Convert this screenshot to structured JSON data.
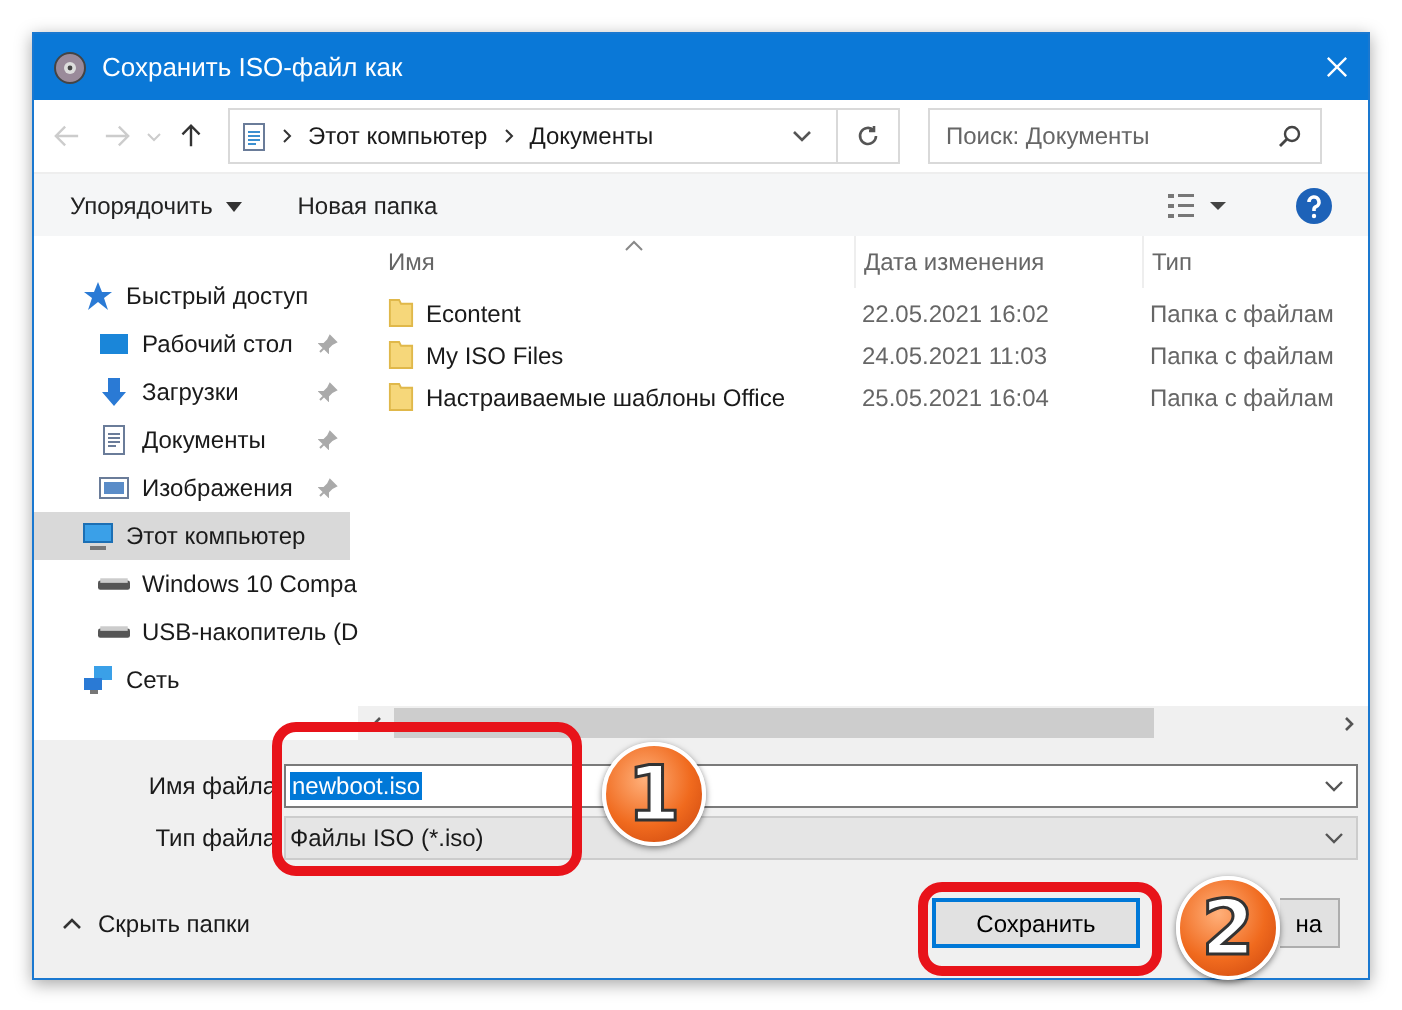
{
  "window": {
    "title": "Сохранить ISO-файл как"
  },
  "address": {
    "path": [
      {
        "label": "Этот компьютер"
      },
      {
        "label": "Документы"
      }
    ]
  },
  "search": {
    "placeholder": "Поиск: Документы"
  },
  "toolbar": {
    "organize": "Упорядочить",
    "new_folder": "Новая папка"
  },
  "sidebar": {
    "items": [
      {
        "label": "Быстрый доступ",
        "kind": "star",
        "selected": false,
        "children": [
          {
            "label": "Рабочий стол",
            "kind": "desktop",
            "selected": false,
            "pinned": true
          },
          {
            "label": "Загрузки",
            "kind": "download",
            "selected": false,
            "pinned": true
          },
          {
            "label": "Документы",
            "kind": "document",
            "selected": false,
            "pinned": true
          },
          {
            "label": "Изображения",
            "kind": "image",
            "selected": false,
            "pinned": true
          }
        ]
      },
      {
        "label": "Этот компьютер",
        "kind": "computer",
        "selected": true,
        "children": [
          {
            "label": "Windows 10 Compa",
            "kind": "drive",
            "selected": false
          },
          {
            "label": "USB-накопитель (D",
            "kind": "drive",
            "selected": false
          }
        ]
      },
      {
        "label": "Сеть",
        "kind": "network",
        "selected": false
      }
    ]
  },
  "table": {
    "columns": [
      "Имя",
      "Дата изменения",
      "Тип"
    ],
    "rows": [
      {
        "name": "Econtent",
        "date": "22.05.2021 16:02",
        "type": "Папка с файлам"
      },
      {
        "name": "My ISO Files",
        "date": "24.05.2021 11:03",
        "type": "Папка с файлам"
      },
      {
        "name": "Настраиваемые шаблоны Office",
        "date": "25.05.2021 16:04",
        "type": "Папка с файлам"
      }
    ]
  },
  "form": {
    "filename_label": "Имя файла",
    "filename_value": "newboot.iso",
    "type_label": "Тип файла",
    "type_value": "Файлы ISO (*.iso)"
  },
  "hide_folders": "Скрыть папки",
  "buttons": [
    {
      "label": "Сохранить",
      "kind": "save"
    },
    {
      "label": "на",
      "kind": "cancel"
    }
  ],
  "annotations": [
    {
      "label": "1"
    },
    {
      "label": "2"
    }
  ]
}
